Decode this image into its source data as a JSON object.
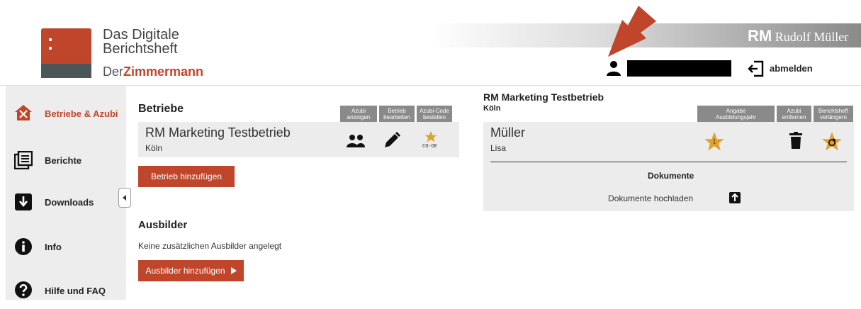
{
  "header": {
    "brand_line1": "Das Digitale",
    "brand_line2": "Berichtsheft",
    "brand_der": "Der",
    "brand_zimmermann": "Zimmermann",
    "publisher_rm": "RM",
    "publisher_name": "Rudolf Müller",
    "logout_label": "abmelden"
  },
  "sidebar": {
    "items": [
      {
        "label": "Betriebe & Azubi",
        "icon": "tools-house-icon"
      },
      {
        "label": "Berichte",
        "icon": "reports-icon"
      },
      {
        "label": "Downloads",
        "icon": "download-icon"
      },
      {
        "label": "Info",
        "icon": "info-icon"
      },
      {
        "label": "Hilfe und FAQ",
        "icon": "help-icon"
      }
    ]
  },
  "betriebe": {
    "title": "Betriebe",
    "col_azubi_anzeigen": [
      "Azubi",
      "anzeigen"
    ],
    "col_betrieb_bearbeiten": [
      "Betrieb",
      "bearbeiten"
    ],
    "col_azubi_code": [
      "Azubi-Code",
      "bestellen"
    ],
    "company_name": "RM Marketing Testbetrieb",
    "company_city": "Köln",
    "code_label": "CO-DE",
    "add_button": "Betrieb hinzufügen"
  },
  "ausbilder": {
    "title": "Ausbilder",
    "empty_text": "Keine zusätzlichen Ausbilder angelegt",
    "add_button": "Ausbilder hinzufügen"
  },
  "detail": {
    "company_name": "RM Marketing Testbetrieb",
    "company_city": "Köln",
    "col_angabe": [
      "Angabe",
      "Ausbildungsjahr"
    ],
    "col_azubi_entfernen": [
      "Azubi",
      "entfernen"
    ],
    "col_berichtsheft": [
      "Berichtsheft",
      "verlängern"
    ],
    "azubi_lastname": "Müller",
    "azubi_firstname": "Lisa",
    "year_badge": "1",
    "documents_title": "Dokumente",
    "upload_label": "Dokumente hochladen"
  },
  "colors": {
    "brand_red": "#c0462b",
    "star_gold": "#e0a12f",
    "header_gray": "#8a8a8a"
  }
}
